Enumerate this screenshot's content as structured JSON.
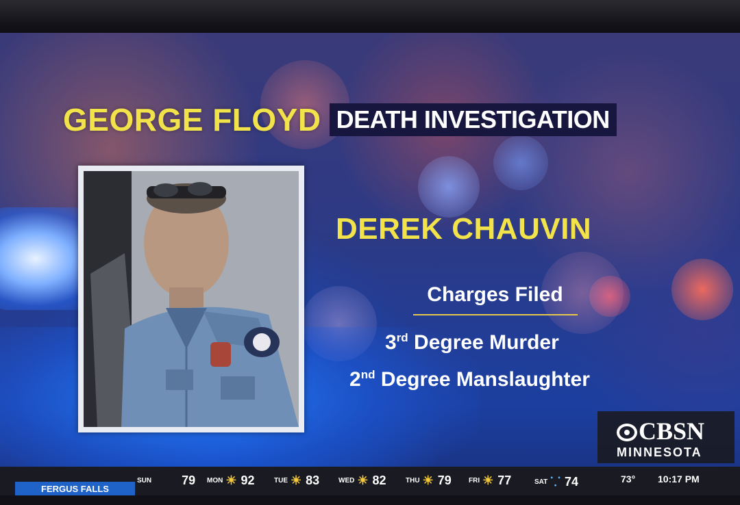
{
  "headline": {
    "primary": "GEORGE FLOYD",
    "secondary": "DEATH INVESTIGATION"
  },
  "subject": {
    "name": "DEREK CHAUVIN",
    "photo_icon": "officer-portrait"
  },
  "charges": {
    "title": "Charges Filed",
    "items": [
      {
        "ordinal": "3",
        "suffix": "rd",
        "text": "Degree Murder"
      },
      {
        "ordinal": "2",
        "suffix": "nd",
        "text": "Degree Manslaughter"
      }
    ]
  },
  "logo": {
    "brand": "CBSN",
    "region": "MINNESOTA"
  },
  "ticker": {
    "location": "FERGUS FALLS",
    "forecast": [
      {
        "day": "SUN",
        "icon": "",
        "temp": "79"
      },
      {
        "day": "MON",
        "icon": "sun-icon",
        "temp": "92"
      },
      {
        "day": "TUE",
        "icon": "sun-icon",
        "temp": "83"
      },
      {
        "day": "WED",
        "icon": "sun-icon",
        "temp": "82"
      },
      {
        "day": "THU",
        "icon": "sun-icon",
        "temp": "79"
      },
      {
        "day": "FRI",
        "icon": "sun-icon",
        "temp": "77"
      },
      {
        "day": "SAT",
        "icon": "rain-icon",
        "temp": "74"
      }
    ],
    "current_temp": "73°",
    "time": "10:17 PM"
  },
  "colors": {
    "headline_yellow": "#f2e34a",
    "label_navy": "#16163f",
    "ticker_blue": "#1f62c8",
    "rule_gold": "#e8c84a"
  }
}
